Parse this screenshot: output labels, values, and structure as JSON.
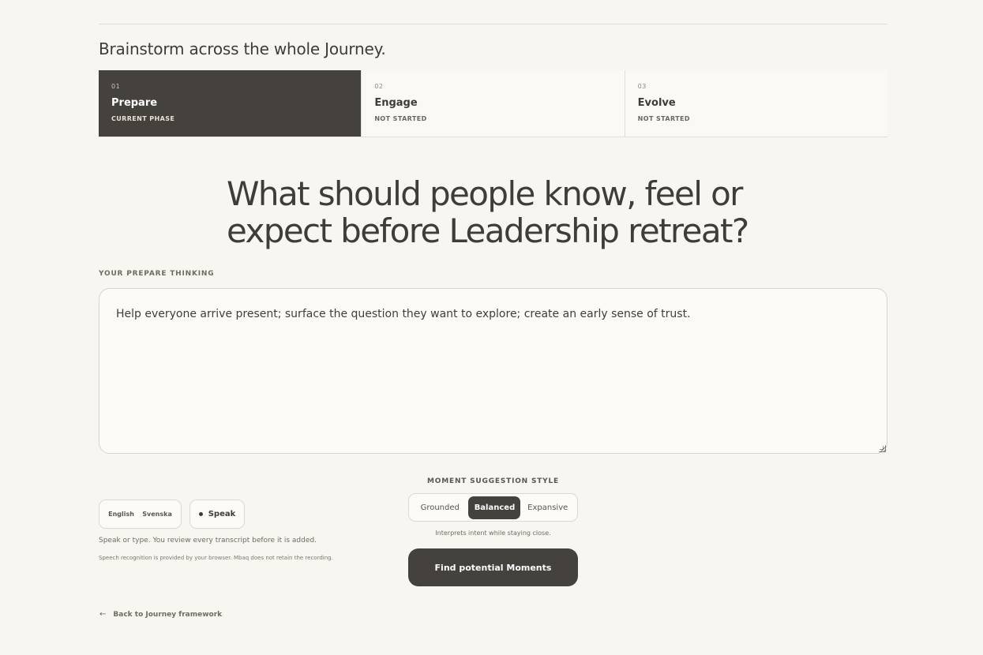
{
  "section": {
    "title": "Brainstorm across the whole Journey."
  },
  "phases": [
    {
      "num": "01",
      "name": "Prepare",
      "status": "CURRENT PHASE",
      "active": true
    },
    {
      "num": "02",
      "name": "Engage",
      "status": "NOT STARTED",
      "active": false
    },
    {
      "num": "03",
      "name": "Evolve",
      "status": "NOT STARTED",
      "active": false
    }
  ],
  "question": "What should people know, feel or expect before Leadership retreat?",
  "thinking": {
    "label": "YOUR PREPARE THINKING",
    "value": "Help everyone arrive present; surface the question they want to explore; create an early sense of trust."
  },
  "voice": {
    "languages": [
      "English",
      "Svenska"
    ],
    "speak_label": "Speak",
    "hint": "Speak or type. You review every transcript before it is added.",
    "privacy": "Speech recognition is provided by your browser. Mbaq does not retain the recording."
  },
  "style": {
    "label": "MOMENT SUGGESTION STYLE",
    "options": [
      "Grounded",
      "Balanced",
      "Expansive"
    ],
    "selected": "Balanced",
    "description": "Interprets intent while staying close."
  },
  "actions": {
    "find_label": "Find potential Moments",
    "back_label": "Back to Journey framework",
    "back_icon": "arrow-left-icon"
  },
  "colors": {
    "background": "#f8f6f1",
    "accent_dark": "#45423e",
    "text": "#3f3c38"
  }
}
